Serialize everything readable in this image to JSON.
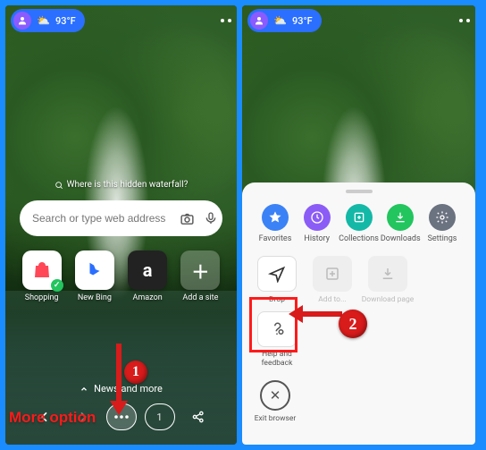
{
  "status": {
    "temp": "93°F"
  },
  "trivia": "Where is this hidden waterfall?",
  "search": {
    "placeholder": "Search or type web address"
  },
  "tiles": {
    "shopping": "Shopping",
    "newbing": "New Bing",
    "amazon": "Amazon",
    "addsite": "Add a site"
  },
  "news_label": "News and more",
  "tabs_count": "1",
  "annotation": {
    "more_option": "More option",
    "step1": "1",
    "step2": "2"
  },
  "panel_top": {
    "favorites": "Favorites",
    "history": "History",
    "collections": "Collections",
    "downloads": "Downloads",
    "settings": "Settings"
  },
  "panel_actions": {
    "drop": "Drop",
    "addto": "Add to...",
    "downloadpage": "Download page",
    "help": "Help and feedback",
    "exit": "Exit browser"
  }
}
